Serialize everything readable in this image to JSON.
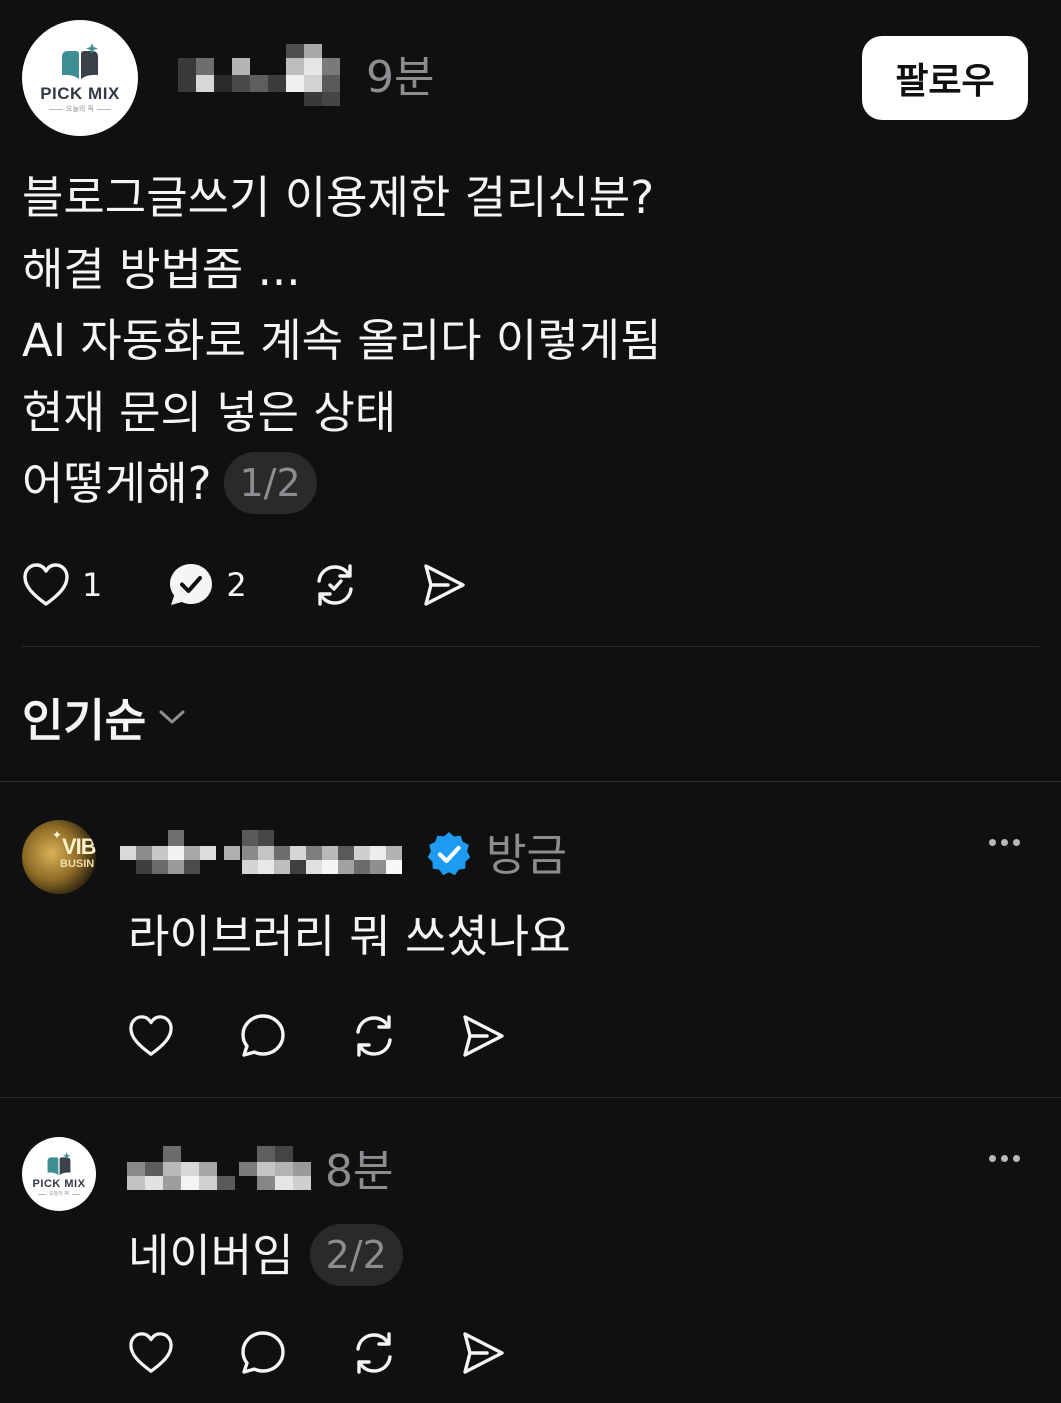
{
  "post": {
    "author_avatar": {
      "brand": "PICK MIX",
      "subtitle": "오늘의 픽"
    },
    "time": "9분",
    "follow_label": "팔로우",
    "lines": [
      "블로그글쓰기 이용제한 걸리신분?",
      "해결 방법좀 ...",
      "AI 자동화로 계속 올리다 이렇게됨",
      "현재 문의 넣은 상태",
      "어떻게해?"
    ],
    "page_indicator": "1/2",
    "like_count": "1",
    "reply_count": "2"
  },
  "sort": {
    "label": "인기순"
  },
  "replies": [
    {
      "avatar": {
        "text_main": "VIB",
        "text_sub": "BUSIN"
      },
      "verified": true,
      "time": "방금",
      "text": "라이브러리 뭐 쓰셨나요"
    },
    {
      "avatar": {
        "brand": "PICK MIX",
        "subtitle": "오늘의 픽"
      },
      "time": "8분",
      "text": "네이버임",
      "page_indicator": "2/2"
    }
  ],
  "icons": {
    "like": "heart-icon",
    "reply": "comment-icon",
    "replied": "comment-check-icon",
    "repost": "repost-icon",
    "share": "send-icon",
    "sort": "chevron-down-icon",
    "more": "more-horizontal-icon",
    "verified": "verified-badge-icon"
  },
  "colors": {
    "background": "#101010",
    "text": "#f3f5f7",
    "muted": "#8b8d90",
    "verified": "#1d9bf0",
    "divider": "#2d2d2d"
  }
}
